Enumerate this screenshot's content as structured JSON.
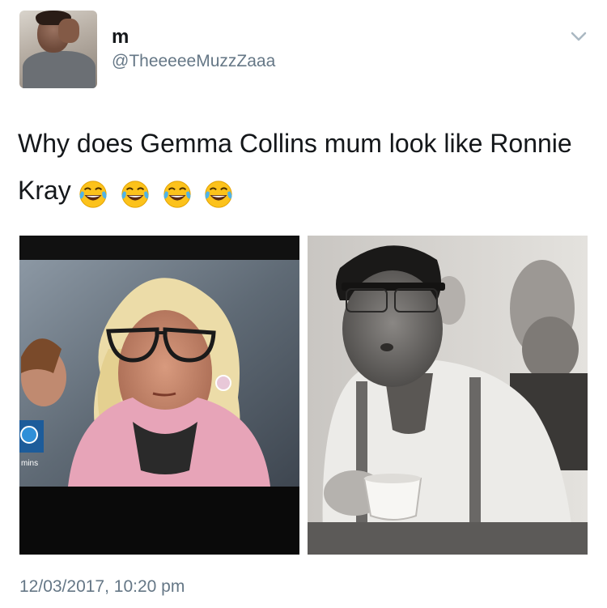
{
  "tweet": {
    "display_name": "m",
    "handle": "@TheeeeeMuzzZaaa",
    "text": "Why does Gemma Collins mum look like Ronnie Kray",
    "emojis": [
      "face-with-tears-of-joy",
      "face-with-tears-of-joy",
      "face-with-tears-of-joy",
      "face-with-tears-of-joy"
    ],
    "timestamp": "12/03/2017, 10:20 pm"
  },
  "media": {
    "left_photo": {
      "overlay_text": "mins"
    },
    "right_photo": {
      "style": "black-and-white"
    }
  },
  "colors": {
    "text": "#14171a",
    "secondary": "#657786",
    "chevron": "#aab8c2"
  }
}
